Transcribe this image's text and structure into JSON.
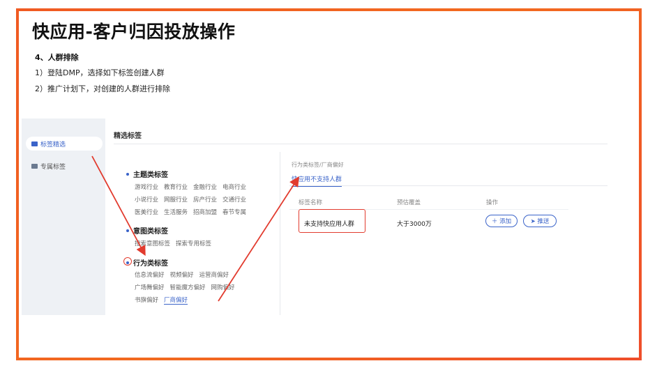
{
  "slide": {
    "title": "快应用-客户归因投放操作",
    "step_title": "4、人群排除",
    "step_lines": [
      "1）登陆DMP，选择如下标签创建人群",
      "2）推广计划下，对创建的人群进行排除"
    ],
    "frame_color": "#f26a1f"
  },
  "app": {
    "sidebar": {
      "items": [
        {
          "label": "标签精选",
          "active": true
        },
        {
          "label": "专属标签",
          "active": false
        }
      ]
    },
    "header": "精选标签",
    "groups": [
      {
        "title": "主题类标签",
        "rows": [
          [
            "游戏行业",
            "教育行业",
            "金融行业",
            "电商行业"
          ],
          [
            "小说行业",
            "网服行业",
            "房产行业",
            "交通行业"
          ],
          [
            "医美行业",
            "生活服务",
            "招商加盟",
            "春节专属"
          ]
        ]
      },
      {
        "title": "意图类标签",
        "rows": [
          [
            "搜索意图标签",
            "探索专用标签"
          ]
        ]
      },
      {
        "title": "行为类标签",
        "rows": [
          [
            "信息流偏好",
            "视频偏好",
            "运营商偏好"
          ],
          [
            "广场舞偏好",
            "智能魔方偏好",
            "网购偏好"
          ],
          [
            "书旗偏好",
            "厂商偏好"
          ]
        ]
      }
    ],
    "right_panel": {
      "breadcrumb": "行为类标签/厂商偏好",
      "tab": "快应用不支持人群",
      "columns": [
        "标签名称",
        "预估覆盖",
        "操作"
      ],
      "row": {
        "name": "未支持快应用人群",
        "coverage": "大于3000万"
      },
      "actions": {
        "add": "＋ 添加",
        "push": "➤ 推送"
      }
    },
    "accent_color": "#3a63c9",
    "annotation_color": "#e23b2e"
  }
}
